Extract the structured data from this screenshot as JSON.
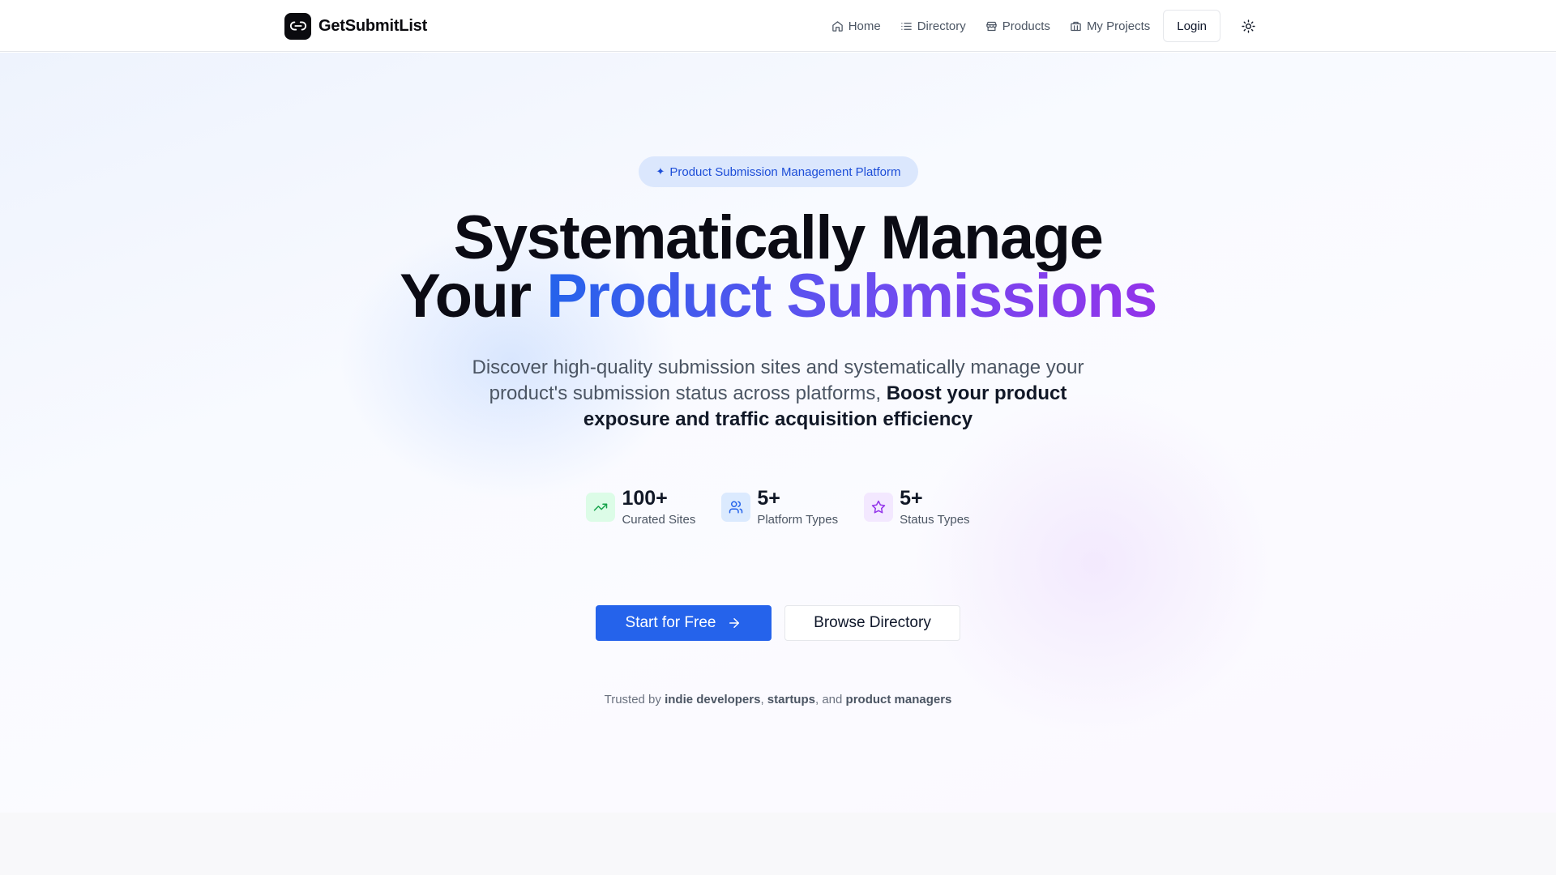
{
  "brand": {
    "name": "GetSubmitList"
  },
  "nav": {
    "items": [
      {
        "label": "Home",
        "icon": "home-icon"
      },
      {
        "label": "Directory",
        "icon": "list-icon"
      },
      {
        "label": "Products",
        "icon": "store-icon"
      },
      {
        "label": "My Projects",
        "icon": "briefcase-icon"
      }
    ],
    "login_label": "Login",
    "theme_icon": "sun-icon"
  },
  "hero": {
    "badge": "Product Submission Management Platform",
    "title_line1": "Systematically Manage",
    "title_line2_plain": "Your",
    "title_line2_gradient": "Product Submissions",
    "subtitle_plain": "Discover high-quality submission sites and systematically manage your product's submission status across platforms,",
    "subtitle_bold": "Boost your product exposure and traffic acquisition efficiency",
    "stats": [
      {
        "value": "100+",
        "label": "Curated Sites",
        "icon": "trending-up-icon"
      },
      {
        "value": "5+",
        "label": "Platform Types",
        "icon": "users-icon"
      },
      {
        "value": "5+",
        "label": "Status Types",
        "icon": "star-icon"
      }
    ],
    "primary_cta": "Start for Free",
    "secondary_cta": "Browse Directory",
    "trusted": {
      "prefix": "Trusted by",
      "group1": "indie developers",
      "sep1": ",",
      "group2": "startups",
      "sep2": ", and",
      "group3": "product managers"
    }
  },
  "colors": {
    "primary": "#2563eb",
    "gradient_start": "#2563eb",
    "gradient_end": "#9333ea",
    "badge_bg": "#dbe7fd"
  }
}
